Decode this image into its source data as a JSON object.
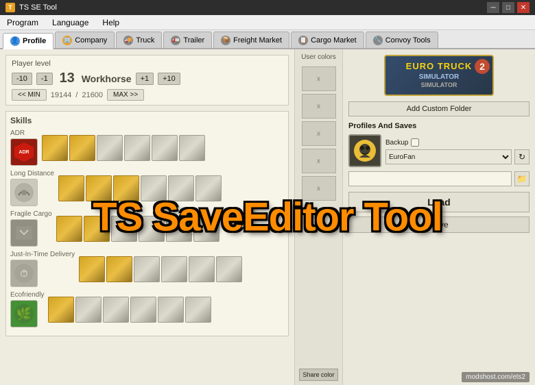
{
  "titleBar": {
    "title": "TS SE Tool",
    "icon": "T"
  },
  "menuBar": {
    "items": [
      "Program",
      "Language",
      "Help"
    ]
  },
  "tabs": [
    {
      "id": "profile",
      "label": "Profile",
      "active": true,
      "iconColor": "#4a90d9"
    },
    {
      "id": "company",
      "label": "Company",
      "active": false,
      "iconColor": "#e8a020"
    },
    {
      "id": "truck",
      "label": "Truck",
      "active": false,
      "iconColor": "#888"
    },
    {
      "id": "trailer",
      "label": "Trailer",
      "active": false,
      "iconColor": "#888"
    },
    {
      "id": "freight",
      "label": "Freight Market",
      "active": false,
      "iconColor": "#888"
    },
    {
      "id": "cargo",
      "label": "Cargo Market",
      "active": false,
      "iconColor": "#888"
    },
    {
      "id": "convoy",
      "label": "Convoy Tools",
      "active": false,
      "iconColor": "#888"
    }
  ],
  "playerLevel": {
    "sectionLabel": "Player level",
    "minusTen": "-10",
    "minusOne": "-1",
    "level": "13",
    "title": "Workhorse",
    "plusOne": "+1",
    "plusTen": "+10",
    "minBtn": "<< MIN",
    "maxBtn": "MAX >>",
    "xpCurrent": "19144",
    "xpMax": "21600",
    "xpSeparator": "/"
  },
  "skills": {
    "title": "Skills",
    "rows": [
      {
        "id": "adr",
        "label": "ADR",
        "filledBlocks": 2,
        "totalBlocks": 6
      },
      {
        "id": "long",
        "label": "Long Distance",
        "filledBlocks": 3,
        "totalBlocks": 6
      },
      {
        "id": "fragile",
        "label": "Fragile Cargo",
        "filledBlocks": 2,
        "totalBlocks": 6
      },
      {
        "id": "lntd",
        "label": "Just-in-Time Delivery",
        "filledBlocks": 2,
        "totalBlocks": 6
      },
      {
        "id": "eco",
        "label": "Ecofriendly",
        "filledBlocks": 1,
        "totalBlocks": 6
      }
    ]
  },
  "userColors": {
    "title": "User colors",
    "swatchLabel": "x",
    "shareColorBtn": "Share color",
    "copyBtn": "x",
    "swatches": [
      "x",
      "x",
      "x",
      "x",
      "x"
    ]
  },
  "rightPanel": {
    "ets2Logo": {
      "line1": "EURO TRUCK",
      "line2": "SIMULATOR",
      "badge": "2"
    },
    "addFolderBtn": "Add Custom Folder",
    "profilesTitle": "Profiles And Saves",
    "profileName": "EuroFan",
    "backupLabel": "Backup",
    "folderPlaceholder": "",
    "loadBtn": "Load",
    "saveBtn": "Save"
  },
  "overlayText": "TS SaveEditor Tool",
  "watermark": "modshost.com/ets2"
}
